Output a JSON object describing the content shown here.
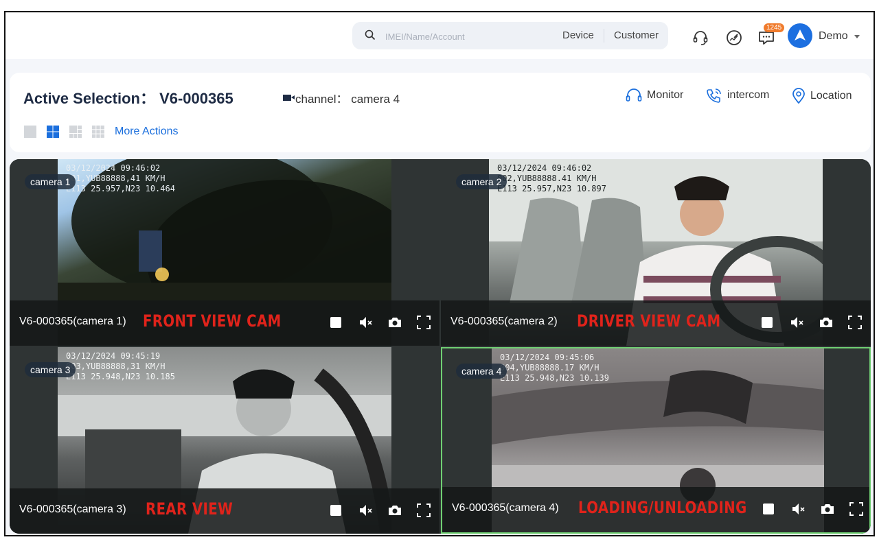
{
  "header": {
    "search_placeholder": "IMEI/Name/Account",
    "search_options": [
      "Device",
      "Customer"
    ],
    "notification_count": "1245",
    "user_name": "Demo"
  },
  "panel": {
    "title": "Active Selection： V6-000365",
    "channel": "channel： camera 4",
    "actions": [
      "Monitor",
      "intercom",
      "Location"
    ],
    "more_actions": "More Actions"
  },
  "cameras": [
    {
      "chip": "camera 1",
      "name": "V6-000365(camera 1)",
      "tag": "FRONT VIEW CAM",
      "osd": [
        "03/12/2024 09:46:02",
        "001,YUB88888,41 KM/H",
        "E113 25.957,N23 10.464"
      ]
    },
    {
      "chip": "camera 2",
      "name": "V6-000365(camera 2)",
      "tag": "DRIVER VIEW CAM",
      "osd": [
        "03/12/2024 09:46:02",
        "002,YUB88888.41 KM/H",
        "E113 25.957,N23 10.897"
      ]
    },
    {
      "chip": "camera 3",
      "name": "V6-000365(camera 3)",
      "tag": "REAR VIEW",
      "osd": [
        "03/12/2024 09:45:19",
        "003,YUB88888,31 KM/H",
        "E113 25.948,N23 10.185"
      ]
    },
    {
      "chip": "camera 4",
      "name": "V6-000365(camera 4)",
      "tag": "LOADING/UNLOADING",
      "osd": [
        "03/12/2024 09:45:06",
        "004,YUB88888.17 KM/H",
        "E113 25.948,N23 10.139"
      ]
    }
  ],
  "icons": {
    "top": [
      "support-headset-icon",
      "dashboard-gauge-icon",
      "messages-icon"
    ],
    "actions": [
      "headset-icon",
      "phone-call-icon",
      "location-pin-icon"
    ],
    "layouts": [
      "layout-1-icon",
      "layout-4-icon",
      "layout-9-icon",
      "layout-16-icon"
    ],
    "controls": [
      "stop-icon",
      "mute-icon",
      "snapshot-icon",
      "fullscreen-icon"
    ]
  },
  "colors": {
    "accent": "#1b6fdd",
    "badge": "#f07b2c",
    "tag_red": "#e0231b",
    "selected_border": "#6fcf72",
    "title_text": "#1e2b44"
  }
}
